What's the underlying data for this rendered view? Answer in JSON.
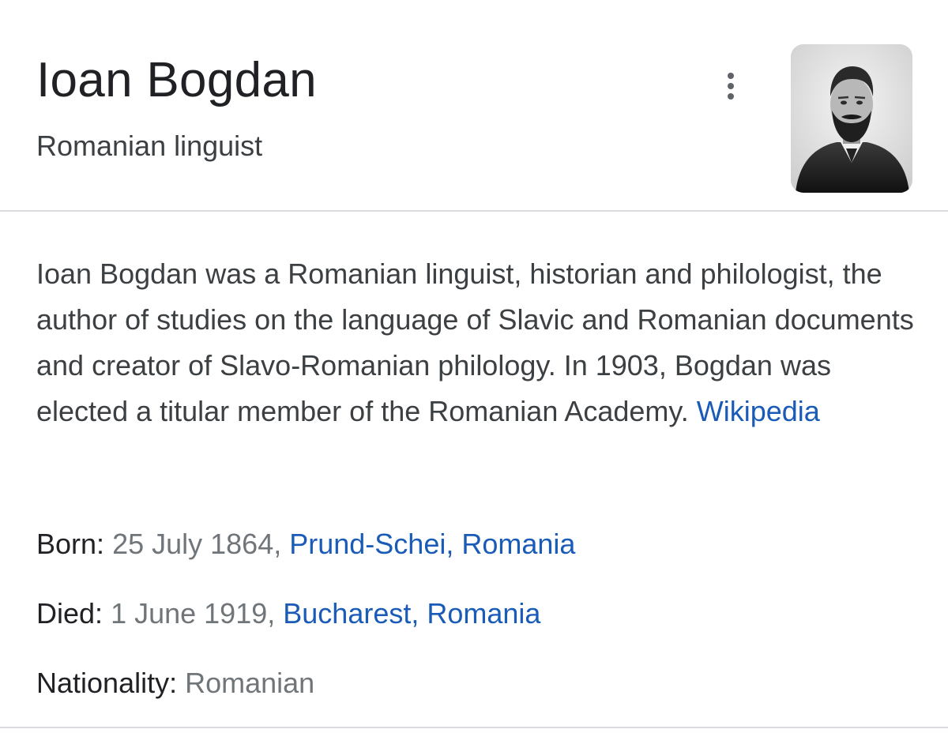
{
  "header": {
    "title": "Ioan Bogdan",
    "subtitle": "Romanian linguist",
    "more_icon": "more-vert-icon",
    "portrait": "portrait-photo"
  },
  "description": {
    "text": "Ioan Bogdan was a Romanian linguist, historian and philologist, the author of studies on the language of Slavic and Romanian documents and creator of Slavo-Romanian philology. In 1903, Bogdan was elected a titular member of the Romanian Academy.",
    "source_link": "Wikipedia"
  },
  "facts": {
    "born": {
      "label": "Born:",
      "date": "25 July 1864,",
      "place_link": "Prund-Schei, Romania"
    },
    "died": {
      "label": "Died:",
      "date": "1 June 1919,",
      "place_link": "Bucharest, Romania"
    },
    "nationality": {
      "label": "Nationality:",
      "value": "Romanian"
    }
  },
  "colors": {
    "link": "#1a5bb8",
    "text": "#202124",
    "secondary_text": "#70757a",
    "divider": "#dadce0"
  }
}
